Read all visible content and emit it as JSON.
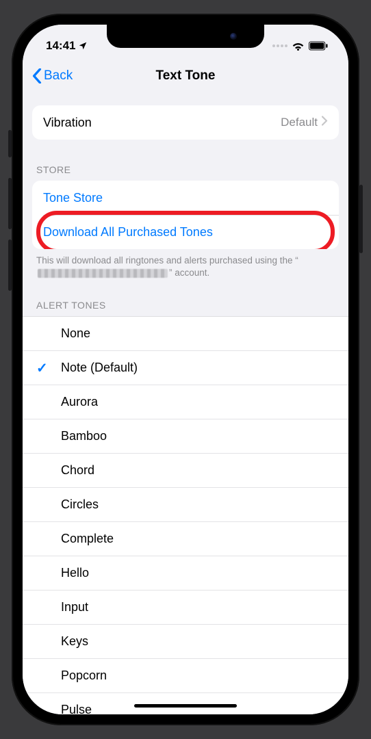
{
  "status": {
    "time": "14:41"
  },
  "nav": {
    "back": "Back",
    "title": "Text Tone"
  },
  "vibration": {
    "label": "Vibration",
    "value": "Default"
  },
  "store": {
    "header": "STORE",
    "tone_store": "Tone Store",
    "download": "Download All Purchased Tones",
    "footer_pre": "This will download all ringtones and alerts purchased using the “",
    "footer_post": "” account."
  },
  "alert": {
    "header": "ALERT TONES",
    "items": [
      {
        "label": "None",
        "selected": false
      },
      {
        "label": "Note (Default)",
        "selected": true
      },
      {
        "label": "Aurora",
        "selected": false
      },
      {
        "label": "Bamboo",
        "selected": false
      },
      {
        "label": "Chord",
        "selected": false
      },
      {
        "label": "Circles",
        "selected": false
      },
      {
        "label": "Complete",
        "selected": false
      },
      {
        "label": "Hello",
        "selected": false
      },
      {
        "label": "Input",
        "selected": false
      },
      {
        "label": "Keys",
        "selected": false
      },
      {
        "label": "Popcorn",
        "selected": false
      },
      {
        "label": "Pulse",
        "selected": false
      }
    ]
  }
}
